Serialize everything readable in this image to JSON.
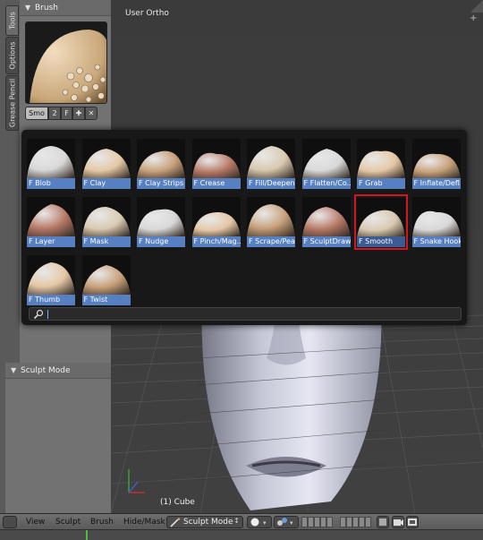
{
  "viewport": {
    "title": "User Ortho",
    "object_label": "(1) Cube"
  },
  "shelf": {
    "tabs": [
      "Tools",
      "Options",
      "Grease Pencil"
    ],
    "brush_panel": {
      "title": "Brush",
      "brush_name": "Smo",
      "users": "2",
      "fake_user": "F",
      "icons": [
        "add-icon",
        "close-icon"
      ]
    },
    "mode_panel": {
      "title": "Sculpt Mode"
    }
  },
  "brush_popup": {
    "selected": "F Smooth",
    "brushes": [
      {
        "label": "F Blob"
      },
      {
        "label": "F Clay"
      },
      {
        "label": "F Clay Strips"
      },
      {
        "label": "F Crease"
      },
      {
        "label": "F Fill/Deepen"
      },
      {
        "label": "F Flatten/Co..."
      },
      {
        "label": "F Grab"
      },
      {
        "label": "F Inflate/Defl..."
      },
      {
        "label": "F Layer"
      },
      {
        "label": "F Mask"
      },
      {
        "label": "F Nudge"
      },
      {
        "label": "F Pinch/Mag..."
      },
      {
        "label": "F Scrape/Pea"
      },
      {
        "label": "F SculptDraw"
      },
      {
        "label": "F Smooth"
      },
      {
        "label": "F Snake Hook"
      },
      {
        "label": "F Thumb"
      },
      {
        "label": "F Twist"
      }
    ],
    "search_value": "",
    "search_icon": "search-icon"
  },
  "header": {
    "menus": [
      "View",
      "Sculpt",
      "Brush",
      "Hide/Mask"
    ],
    "mode": "Sculpt Mode",
    "accent": "#5680c2",
    "selection_color": "#d0161f"
  }
}
